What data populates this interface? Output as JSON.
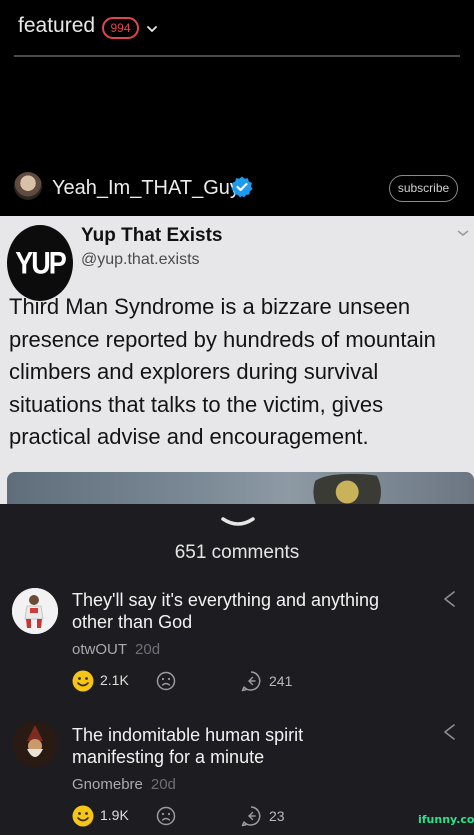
{
  "header": {
    "title": "featured",
    "count_badge": "994",
    "chevron_icon": "chevron-down-icon"
  },
  "post": {
    "author_name": "Yeah_Im_THAT_Guy",
    "subscribe_label": "subscribe",
    "verified_icon": "verified-badge-icon"
  },
  "card": {
    "logo_text": "YUP",
    "account_name": "Yup That Exists",
    "handle": "@yup.that.exists",
    "body_lines": [
      "Third Man Syndrome is a bizzare unseen",
      "presence reported by hundreds of mountain",
      "climbers and explorers during survival",
      "situations that talks to the victim, gives",
      "practical advise and encouragement."
    ]
  },
  "comments": {
    "count_label": "651 comments",
    "items": [
      {
        "text_lines": [
          "They'll say it's everything and anything",
          "other than God"
        ],
        "author": "otwOUT",
        "age": "20d",
        "smile_count": "2.1K",
        "reply_count": "241"
      },
      {
        "text_lines": [
          "The indomitable human spirit",
          "manifesting for a minute"
        ],
        "author": "Gnomebre",
        "age": "20d",
        "smile_count": "1.9K",
        "reply_count": "23"
      }
    ]
  },
  "watermark": "ifunny.co",
  "colors": {
    "accent_red": "#e0474c",
    "smile_yellow": "#f5c518",
    "verified_blue": "#1d9bf0",
    "watermark_green": "#27e38a"
  }
}
